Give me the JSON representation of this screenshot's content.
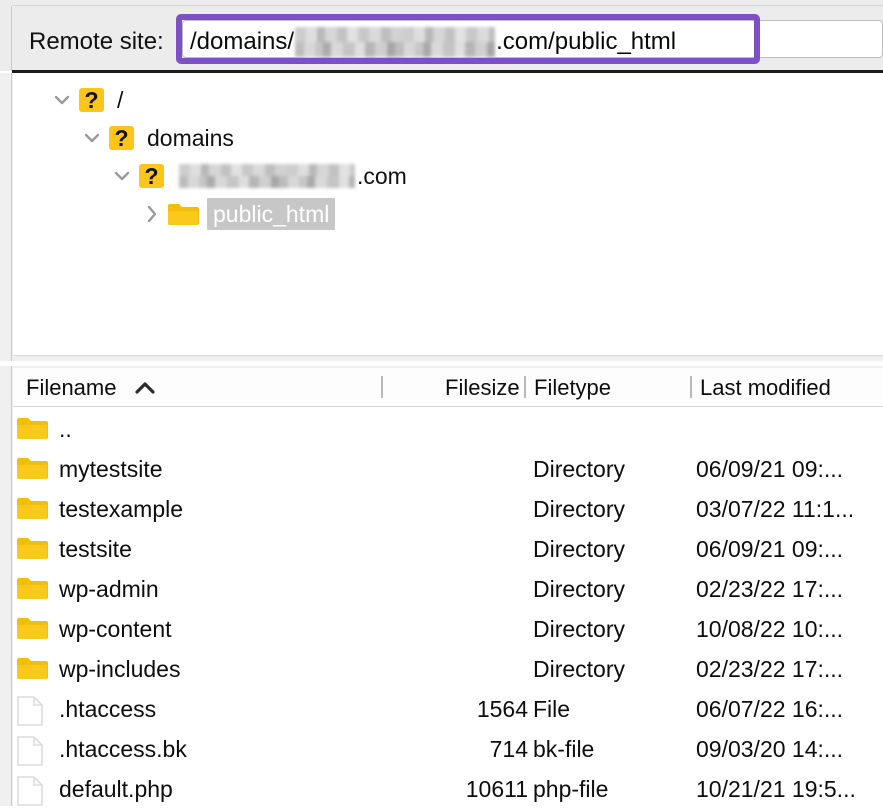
{
  "header": {
    "label": "Remote site:",
    "path_prefix": "/domains/",
    "path_redacted": "[redacted-domain]",
    "path_suffix": ".com/public_html",
    "accent_color": "#7e50c8",
    "field_placeholder": "Remote path"
  },
  "tree": {
    "items": [
      {
        "label": "/",
        "icon": "question-folder-icon",
        "chevron": "chevron-down-icon",
        "indent": 34,
        "selected": false
      },
      {
        "label": "domains",
        "icon": "question-folder-icon",
        "chevron": "chevron-down-icon",
        "indent": 64,
        "selected": false
      },
      {
        "label": "",
        "redacted": true,
        "suffix": ".com",
        "icon": "question-folder-icon",
        "chevron": "chevron-down-icon",
        "indent": 94,
        "selected": false
      },
      {
        "label": "public_html",
        "icon": "folder-icon",
        "chevron": "chevron-right-icon",
        "indent": 124,
        "selected": true
      }
    ],
    "selection_bg": "#c7c7c7"
  },
  "list": {
    "columns": [
      {
        "key": "filename",
        "label": "Filename",
        "sorted": true,
        "sort_dir": "asc"
      },
      {
        "key": "filesize",
        "label": "Filesize"
      },
      {
        "key": "filetype",
        "label": "Filetype"
      },
      {
        "key": "modified",
        "label": "Last modified"
      }
    ],
    "rows": [
      {
        "name": "..",
        "size": "",
        "type": "",
        "modified": "",
        "icon": "folder-icon"
      },
      {
        "name": "mytestsite",
        "size": "",
        "type": "Directory",
        "modified": "06/09/21 09:...",
        "icon": "folder-icon"
      },
      {
        "name": "testexample",
        "size": "",
        "type": "Directory",
        "modified": "03/07/22 11:1...",
        "icon": "folder-icon"
      },
      {
        "name": "testsite",
        "size": "",
        "type": "Directory",
        "modified": "06/09/21 09:...",
        "icon": "folder-icon"
      },
      {
        "name": "wp-admin",
        "size": "",
        "type": "Directory",
        "modified": "02/23/22 17:...",
        "icon": "folder-icon"
      },
      {
        "name": "wp-content",
        "size": "",
        "type": "Directory",
        "modified": "10/08/22 10:...",
        "icon": "folder-icon"
      },
      {
        "name": "wp-includes",
        "size": "",
        "type": "Directory",
        "modified": "02/23/22 17:...",
        "icon": "folder-icon"
      },
      {
        "name": ".htaccess",
        "size": "1564",
        "type": "File",
        "modified": "06/07/22 16:...",
        "icon": "file-icon"
      },
      {
        "name": ".htaccess.bk",
        "size": "714",
        "type": "bk-file",
        "modified": "09/03/20 14:...",
        "icon": "file-icon"
      },
      {
        "name": "default.php",
        "size": "10611",
        "type": "php-file",
        "modified": "10/21/21 19:5...",
        "icon": "file-icon"
      }
    ]
  },
  "colors": {
    "folder_yellow": "#fbc91b",
    "folder_yellow_dark": "#f5bd09",
    "panel_bg": "#ececec",
    "content_bg": "#ffffff"
  }
}
